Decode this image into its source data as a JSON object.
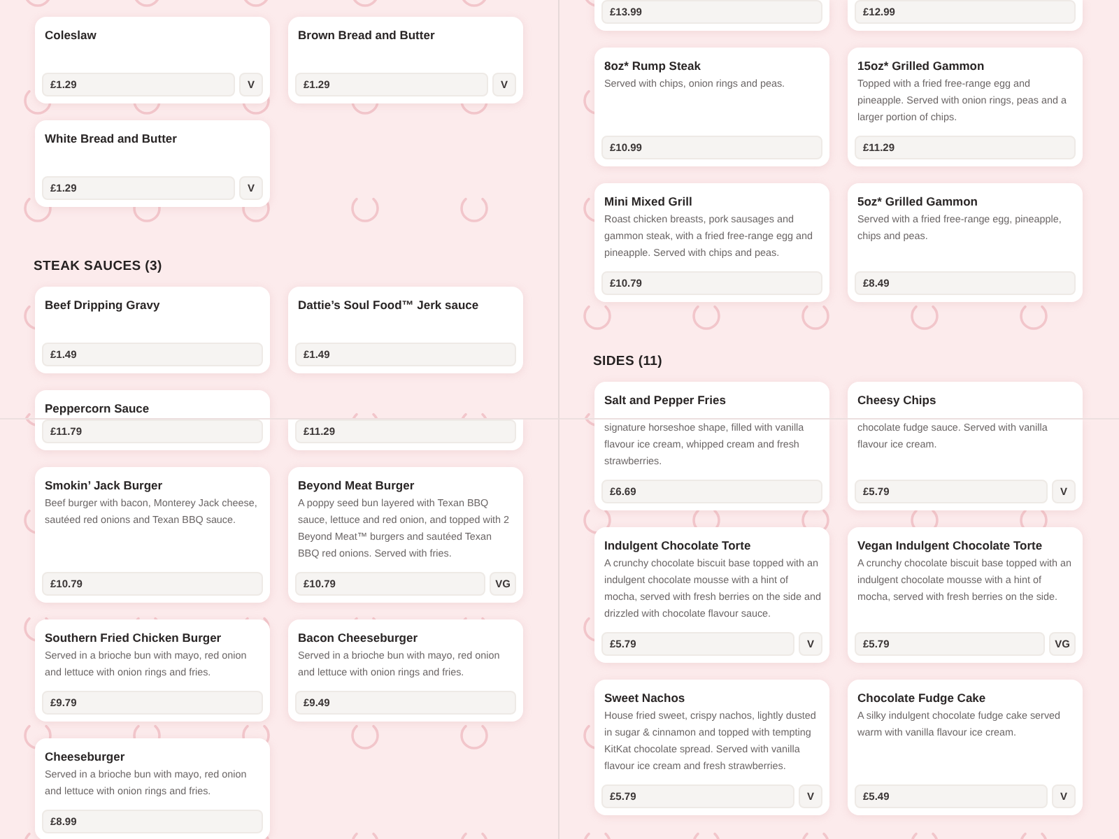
{
  "panels": [
    {
      "sections": [
        {
          "items": [
            {
              "name": "Coleslaw",
              "price": "£1.29",
              "badge": "V"
            },
            {
              "name": "Brown Bread and Butter",
              "price": "£1.29",
              "badge": "V"
            },
            {
              "name": "White Bread and Butter",
              "price": "£1.29",
              "badge": "V"
            }
          ]
        },
        {
          "heading": "STEAK SAUCES (3)",
          "items": [
            {
              "name": "Beef Dripping Gravy",
              "price": "£1.49"
            },
            {
              "name": "Dattie’s Soul Food™ Jerk sauce",
              "price": "£1.49"
            },
            {
              "name": "Peppercorn Sauce"
            }
          ]
        }
      ]
    },
    {
      "sections": [
        {
          "items": [
            {
              "price": "£11.79"
            },
            {
              "price": "£11.29"
            },
            {
              "name": "Smokin’ Jack Burger",
              "description": "Beef burger with bacon, Monterey Jack cheese, sautéed red onions and Texan BBQ sauce.",
              "price": "£10.79"
            },
            {
              "name": "Beyond Meat Burger",
              "description": "A poppy seed bun layered with Texan BBQ sauce, lettuce and red onion, and topped with 2 Beyond Meat™ burgers and sautéed Texan BBQ red onions. Served with fries.",
              "price": "£10.79",
              "badge": "VG"
            },
            {
              "name": "Southern Fried Chicken Burger",
              "description": "Served in a brioche bun with mayo, red onion and lettuce with onion rings and fries.",
              "price": "£9.79"
            },
            {
              "name": "Bacon Cheeseburger",
              "description": "Served in a brioche bun with mayo, red onion and lettuce with onion rings and fries.",
              "price": "£9.49"
            },
            {
              "name": "Cheeseburger",
              "description": "Served in a brioche bun with mayo, red onion and lettuce with onion rings and fries.",
              "price": "£8.99"
            }
          ]
        }
      ]
    },
    {
      "sections": [
        {
          "items": [
            {
              "price": "£13.99"
            },
            {
              "price": "£12.99"
            },
            {
              "name": "8oz* Rump Steak",
              "description": "Served with chips, onion rings and peas.",
              "price": "£10.99"
            },
            {
              "name": "15oz* Grilled Gammon",
              "description": "Topped with a fried free-range egg and pineapple. Served with onion rings, peas and a larger portion of chips.",
              "price": "£11.29"
            },
            {
              "name": "Mini Mixed Grill",
              "description": "Roast chicken breasts, pork sausages and gammon steak, with a fried free-range egg and pineapple. Served with chips and peas.",
              "price": "£10.79"
            },
            {
              "name": "5oz* Grilled Gammon",
              "description": "Served with a fried free-range egg, pineapple, chips and peas.",
              "price": "£8.49"
            }
          ]
        },
        {
          "heading": "SIDES (11)",
          "items": [
            {
              "name": "Salt and Pepper Fries"
            },
            {
              "name": "Cheesy Chips"
            }
          ]
        }
      ]
    },
    {
      "sections": [
        {
          "items": [
            {
              "description": "signature horseshoe shape, filled with vanilla flavour ice cream, whipped cream and fresh strawberries.",
              "price": "£6.69"
            },
            {
              "description": "chocolate fudge sauce. Served with vanilla flavour ice cream.",
              "price": "£5.79",
              "badge": "V"
            },
            {
              "name": "Indulgent Chocolate Torte",
              "description": "A crunchy chocolate biscuit base topped with an indulgent chocolate mousse with a hint of mocha, served with fresh berries on the side and drizzled with chocolate flavour sauce.",
              "price": "£5.79",
              "badge": "V"
            },
            {
              "name": "Vegan Indulgent Chocolate Torte",
              "description": "A crunchy chocolate biscuit base topped with an indulgent chocolate mousse with a hint of mocha, served with fresh berries on the side.",
              "price": "£5.79",
              "badge": "VG"
            },
            {
              "name": "Sweet Nachos",
              "description": "House fried sweet, crispy nachos, lightly dusted in sugar & cinnamon and topped with tempting KitKat chocolate spread. Served with vanilla flavour ice cream and fresh strawberries.",
              "price": "£5.79",
              "badge": "V"
            },
            {
              "name": "Chocolate Fudge Cake",
              "description": "A silky indulgent chocolate fudge cake served warm with vanilla flavour ice cream.",
              "price": "£5.49",
              "badge": "V"
            }
          ]
        }
      ]
    }
  ]
}
